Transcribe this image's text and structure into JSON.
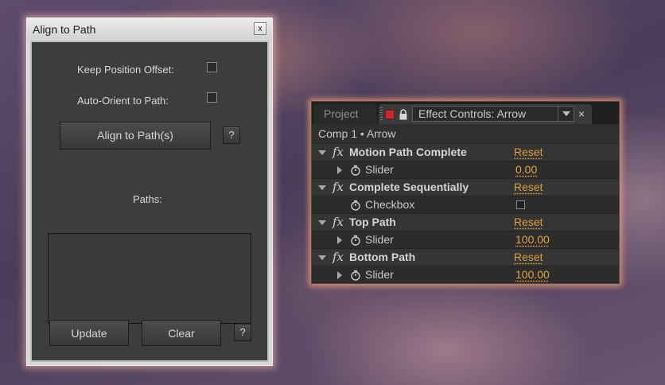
{
  "align_dialog": {
    "title": "Align to Path",
    "close_label": "x",
    "keep_position_offset_label": "Keep Position Offset:",
    "keep_position_offset_checked": false,
    "auto_orient_label": "Auto-Orient to Path:",
    "auto_orient_checked": false,
    "align_button": "Align to Path(s)",
    "help_label": "?",
    "paths_label": "Paths:",
    "paths": [],
    "update_button": "Update",
    "clear_button": "Clear"
  },
  "effect_panel": {
    "tabs": {
      "project": "Project",
      "active": "Effect Controls: Arrow"
    },
    "close_label": "×",
    "header": "Comp 1 • Arrow",
    "fx_symbol": "fx",
    "reset_label": "Reset",
    "effects": [
      {
        "name": "Motion Path Complete",
        "param": {
          "name": "Slider",
          "value": "0.00"
        }
      },
      {
        "name": "Complete Sequentially",
        "param": {
          "name": "Checkbox",
          "checked": false
        }
      },
      {
        "name": "Top Path",
        "param": {
          "name": "Slider",
          "value": "100.00"
        }
      },
      {
        "name": "Bottom Path",
        "param": {
          "name": "Slider",
          "value": "100.00"
        }
      }
    ],
    "colors": {
      "accent": "#e3a83a",
      "label_color": "#c32c2c"
    }
  }
}
